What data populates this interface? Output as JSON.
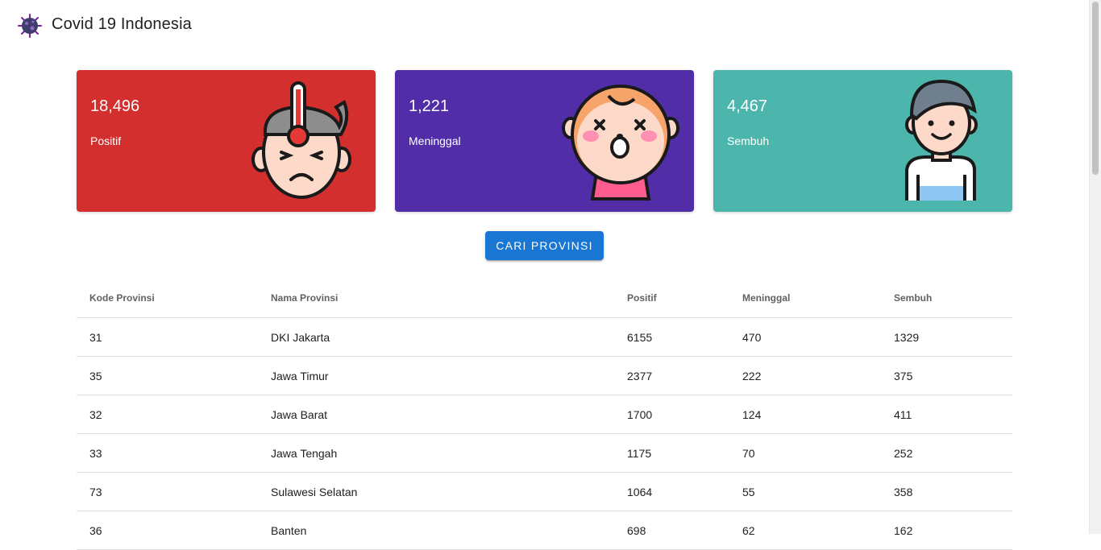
{
  "app": {
    "title": "Covid 19 Indonesia",
    "logo_icon": "virus-icon"
  },
  "cards": [
    {
      "value": "18,496",
      "label": "Positif",
      "color": "#d32f2f",
      "illustration": "sick-fever-face-icon"
    },
    {
      "value": "1,221",
      "label": "Meninggal",
      "color": "#512da8",
      "illustration": "dead-face-icon"
    },
    {
      "value": "4,467",
      "label": "Sembuh",
      "color": "#4db6ac",
      "illustration": "recovered-person-icon"
    }
  ],
  "search_button": {
    "label": "CARI PROVINSI",
    "color": "#1976d2"
  },
  "table": {
    "headers": [
      "Kode Provinsi",
      "Nama Provinsi",
      "Positif",
      "Meninggal",
      "Sembuh"
    ],
    "rows": [
      [
        "31",
        "DKI Jakarta",
        "6155",
        "470",
        "1329"
      ],
      [
        "35",
        "Jawa Timur",
        "2377",
        "222",
        "375"
      ],
      [
        "32",
        "Jawa Barat",
        "1700",
        "124",
        "411"
      ],
      [
        "33",
        "Jawa Tengah",
        "1175",
        "70",
        "252"
      ],
      [
        "73",
        "Sulawesi Selatan",
        "1064",
        "55",
        "358"
      ],
      [
        "36",
        "Banten",
        "698",
        "62",
        "162"
      ]
    ]
  }
}
